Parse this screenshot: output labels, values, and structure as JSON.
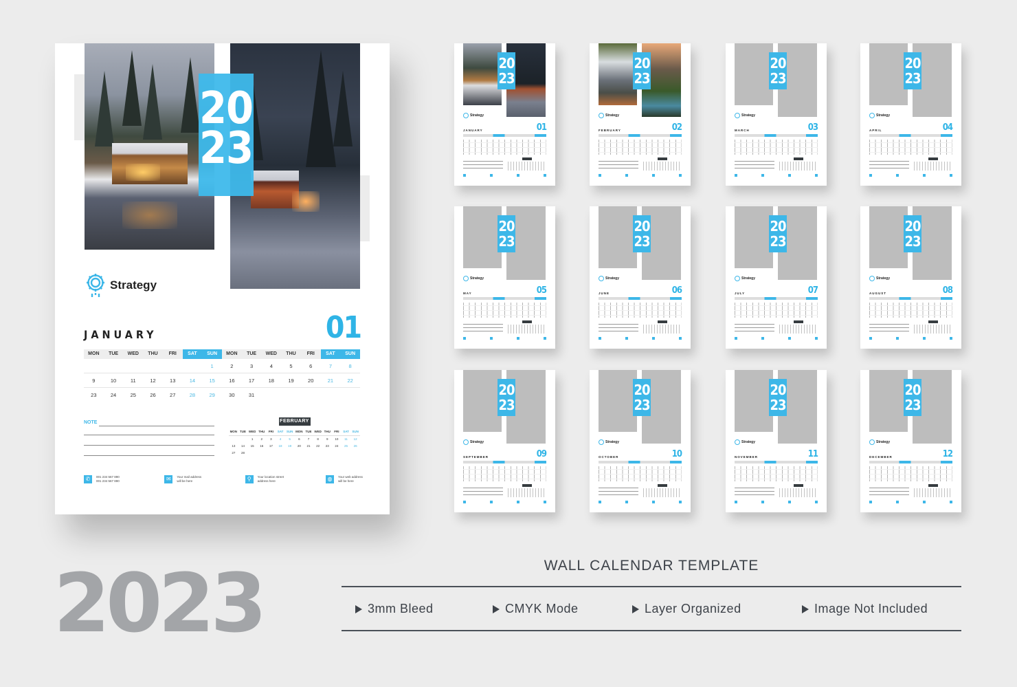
{
  "main_calendar": {
    "year_top": "20",
    "year_bottom": "23",
    "brand": "Strategy",
    "month": "JANUARY",
    "month_number": "01",
    "weekday_headers": [
      "MON",
      "TUE",
      "WED",
      "THU",
      "FRI",
      "SAT",
      "SUN",
      "MON",
      "TUE",
      "WED",
      "THU",
      "FRI",
      "SAT",
      "SUN"
    ],
    "rows": [
      [
        "",
        "",
        "",
        "",
        "",
        "",
        "1",
        "2",
        "3",
        "4",
        "5",
        "6",
        "7",
        "8"
      ],
      [
        "9",
        "10",
        "11",
        "12",
        "13",
        "14",
        "15",
        "16",
        "17",
        "18",
        "19",
        "20",
        "21",
        "22"
      ],
      [
        "23",
        "24",
        "25",
        "26",
        "27",
        "28",
        "29",
        "30",
        "31",
        "",
        "",
        "",
        "",
        ""
      ]
    ],
    "note_label": "NOTE",
    "next_month": {
      "label": "FEBRUARY",
      "headers": [
        "MON",
        "TUE",
        "WED",
        "THU",
        "FRI",
        "SAT",
        "SUN",
        "MON",
        "TUE",
        "WED",
        "THU",
        "FRI",
        "SAT",
        "SUN"
      ],
      "rows": [
        [
          "",
          "",
          "1",
          "2",
          "3",
          "4",
          "5",
          "6",
          "7",
          "8",
          "9",
          "10",
          "11",
          "12"
        ],
        [
          "13",
          "14",
          "15",
          "16",
          "17",
          "18",
          "19",
          "20",
          "21",
          "22",
          "23",
          "24",
          "25",
          "26"
        ],
        [
          "27",
          "28",
          "",
          "",
          "",
          "",
          "",
          "",
          "",
          "",
          "",
          "",
          "",
          ""
        ]
      ]
    },
    "contacts": [
      {
        "icon": "phone-icon",
        "glyph": "✆",
        "lines": [
          "001 234 567 890",
          "001 234 567 890"
        ]
      },
      {
        "icon": "mail-icon",
        "glyph": "✉",
        "lines": [
          "Your mail address",
          "will be here"
        ]
      },
      {
        "icon": "location-icon",
        "glyph": "⚲",
        "lines": [
          "Your location street",
          "address here"
        ]
      },
      {
        "icon": "globe-icon",
        "glyph": "◍",
        "lines": [
          "Your web address",
          "will be here"
        ]
      }
    ]
  },
  "thumbnails": [
    {
      "month": "JANUARY",
      "number": "01",
      "photo": "winter"
    },
    {
      "month": "FEBRUARY",
      "number": "02",
      "photo": "waterfall"
    },
    {
      "month": "MARCH",
      "number": "03",
      "photo": "placeholder"
    },
    {
      "month": "APRIL",
      "number": "04",
      "photo": "placeholder"
    },
    {
      "month": "MAY",
      "number": "05",
      "photo": "placeholder"
    },
    {
      "month": "JUNE",
      "number": "06",
      "photo": "placeholder"
    },
    {
      "month": "JULY",
      "number": "07",
      "photo": "placeholder"
    },
    {
      "month": "AUGUST",
      "number": "08",
      "photo": "placeholder"
    },
    {
      "month": "SEPTEMBER",
      "number": "09",
      "photo": "placeholder"
    },
    {
      "month": "OCTOBER",
      "number": "10",
      "photo": "placeholder"
    },
    {
      "month": "NOVEMBER",
      "number": "11",
      "photo": "placeholder"
    },
    {
      "month": "DECEMBER",
      "number": "12",
      "photo": "placeholder"
    }
  ],
  "thumb_year": {
    "top": "20",
    "bottom": "23"
  },
  "thumb_brand": "Strategy",
  "big_year": "2023",
  "template_title": "WALL CALENDAR TEMPLATE",
  "features": [
    "3mm Bleed",
    "CMYK Mode",
    "Layer Organized",
    "Image Not Included"
  ],
  "colors": {
    "accent": "#3db7e8",
    "background": "#ececec",
    "big_year": "#a3a5a8",
    "text_dark": "#3d4249"
  }
}
